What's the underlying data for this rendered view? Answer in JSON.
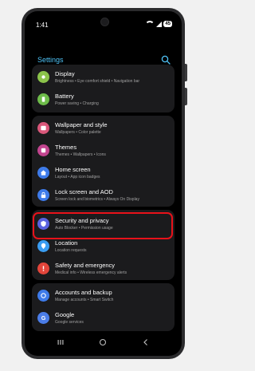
{
  "status": {
    "time": "1:41",
    "battery": "45"
  },
  "header": {
    "title": "Settings"
  },
  "groups": [
    {
      "items": [
        {
          "label": "Display",
          "sub": "Brightness • Eye comfort shield • Navigation bar",
          "color": "#8bc34a",
          "icon": "sun-icon"
        },
        {
          "label": "Battery",
          "sub": "Power saving • Charging",
          "color": "#6ebc4a",
          "icon": "battery-icon"
        }
      ]
    },
    {
      "items": [
        {
          "label": "Wallpaper and style",
          "sub": "Wallpapers • Color palette",
          "color": "#d9577a",
          "icon": "image-icon"
        },
        {
          "label": "Themes",
          "sub": "Themes • Wallpapers • Icons",
          "color": "#c2448f",
          "icon": "themes-icon"
        },
        {
          "label": "Home screen",
          "sub": "Layout • App icon badges",
          "color": "#3e7bea",
          "icon": "home-icon"
        },
        {
          "label": "Lock screen and AOD",
          "sub": "Screen lock and biometrics • Always On Display",
          "color": "#3e7bea",
          "icon": "lock-icon"
        }
      ]
    },
    {
      "items": [
        {
          "label": "Security and privacy",
          "sub": "Auto Blocker • Permission usage",
          "color": "#5a62e0",
          "icon": "shield-icon"
        },
        {
          "label": "Location",
          "sub": "Location requests",
          "color": "#3a9df2",
          "icon": "location-icon"
        },
        {
          "label": "Safety and emergency",
          "sub": "Medical info • Wireless emergency alerts",
          "color": "#e3453b",
          "icon": "alert-icon"
        }
      ]
    },
    {
      "items": [
        {
          "label": "Accounts and backup",
          "sub": "Manage accounts • Smart Switch",
          "color": "#3e7bea",
          "icon": "sync-icon"
        },
        {
          "label": "Google",
          "sub": "Google services",
          "color": "#4b7de8",
          "icon": "google-icon"
        }
      ]
    }
  ]
}
